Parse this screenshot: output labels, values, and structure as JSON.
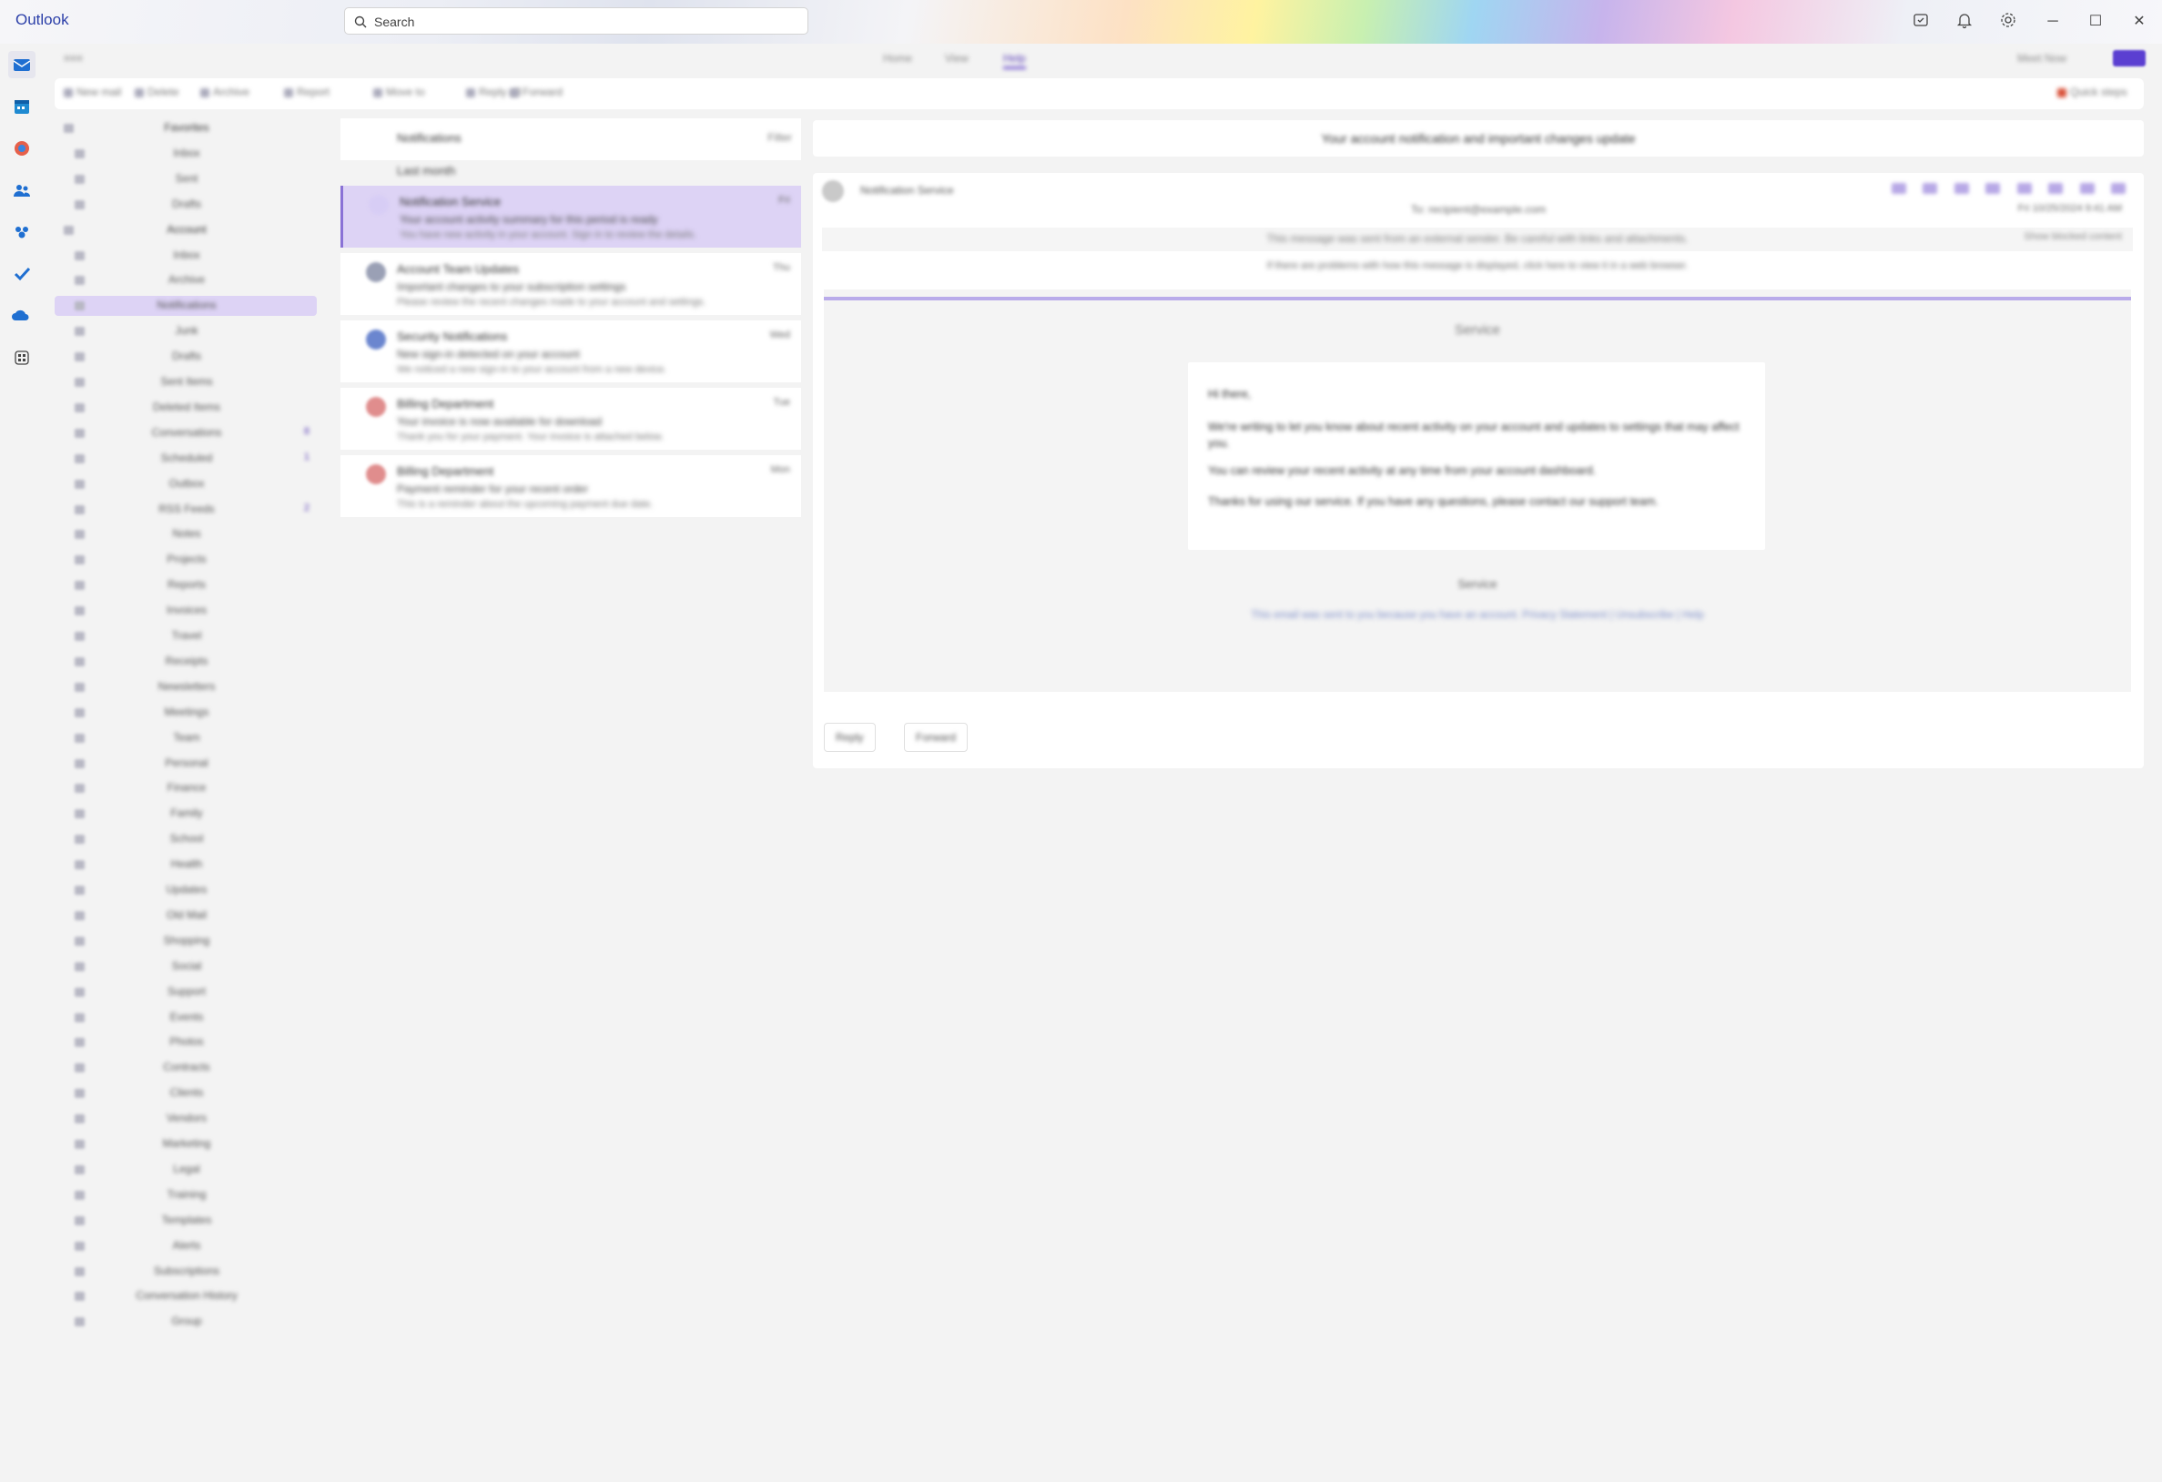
{
  "app": {
    "title": "Outlook"
  },
  "search": {
    "placeholder": "Search"
  },
  "titlebar_icons": [
    "my-day-icon",
    "bell-icon",
    "gear-icon"
  ],
  "window_controls": {
    "minimize": "─",
    "maximize": "☐",
    "close": "✕"
  },
  "rail": {
    "items": [
      "mail-icon",
      "calendar-icon",
      "copilot-icon",
      "people-icon",
      "groups-icon",
      "todo-icon",
      "onedrive-icon",
      "apps-icon"
    ]
  },
  "ribbon": {
    "menu": "≡≡≡",
    "tabs": [
      "Home",
      "View",
      "Help"
    ],
    "commands": [
      "New mail",
      "Delete",
      "Archive",
      "Report",
      "Move to",
      "Reply all",
      "Forward",
      "Quick steps"
    ],
    "right_label": "Meet Now"
  },
  "folders": {
    "items": [
      {
        "label": "Favorites",
        "section": true
      },
      {
        "label": "Inbox"
      },
      {
        "label": "Sent"
      },
      {
        "label": "Drafts"
      },
      {
        "label": "Account",
        "section": true
      },
      {
        "label": "Inbox"
      },
      {
        "label": "Archive"
      },
      {
        "label": "Notifications",
        "selected": true
      },
      {
        "label": "Junk"
      },
      {
        "label": "Drafts"
      },
      {
        "label": "Sent Items"
      },
      {
        "label": "Deleted Items"
      },
      {
        "label": "Conversations",
        "count": "8"
      },
      {
        "label": "Scheduled",
        "count": "1"
      },
      {
        "label": "Outbox"
      },
      {
        "label": "RSS Feeds",
        "count": "2"
      },
      {
        "label": "Notes"
      },
      {
        "label": "Projects"
      },
      {
        "label": "Reports"
      },
      {
        "label": "Invoices"
      },
      {
        "label": "Travel"
      },
      {
        "label": "Receipts"
      },
      {
        "label": "Newsletters"
      },
      {
        "label": "Meetings"
      },
      {
        "label": "Team"
      },
      {
        "label": "Personal"
      },
      {
        "label": "Finance"
      },
      {
        "label": "Family"
      },
      {
        "label": "School"
      },
      {
        "label": "Health"
      },
      {
        "label": "Updates"
      },
      {
        "label": "Old Mail"
      },
      {
        "label": "Shopping"
      },
      {
        "label": "Social"
      },
      {
        "label": "Support"
      },
      {
        "label": "Events"
      },
      {
        "label": "Photos"
      },
      {
        "label": "Contracts"
      },
      {
        "label": "Clients"
      },
      {
        "label": "Vendors"
      },
      {
        "label": "Marketing"
      },
      {
        "label": "Legal"
      },
      {
        "label": "Training"
      },
      {
        "label": "Templates"
      },
      {
        "label": "Alerts"
      },
      {
        "label": "Subscriptions"
      },
      {
        "label": "Conversation History"
      },
      {
        "label": "Group"
      }
    ]
  },
  "message_list": {
    "title": "Notifications",
    "group_label": "Last month",
    "tools": "Filter",
    "messages": [
      {
        "sender": "Notification Service",
        "time": "Fri",
        "subject": "Your account activity summary for this period is ready",
        "preview": "You have new activity in your account. Sign in to review the details.",
        "avatar": "#d7cdf5",
        "selected": true
      },
      {
        "sender": "Account Team Updates",
        "time": "Thu",
        "subject": "Important changes to your subscription settings",
        "preview": "Please review the recent changes made to your account and settings.",
        "avatar": "#9aa0b5"
      },
      {
        "sender": "Security Notifications",
        "time": "Wed",
        "subject": "New sign-in detected on your account",
        "preview": "We noticed a new sign-in to your account from a new device.",
        "avatar": "#6b86cf"
      },
      {
        "sender": "Billing Department",
        "time": "Tue",
        "subject": "Your invoice is now available for download",
        "preview": "Thank you for your payment. Your invoice is attached below.",
        "avatar": "#e08d8d"
      },
      {
        "sender": "Billing Department",
        "time": "Mon",
        "subject": "Payment reminder for your recent order",
        "preview": "This is a reminder about the upcoming payment due date.",
        "avatar": "#e08d8d"
      }
    ]
  },
  "reading_pane": {
    "subject": "Your account notification and important changes update",
    "from": "Notification Service",
    "to": "To: recipient@example.com",
    "date": "Fri 10/25/2024 9:41 AM",
    "notice": "This message was sent from an external sender. Be careful with links and attachments.",
    "notice_button": "Show blocked content",
    "info": "If there are problems with how this message is displayed, click here to view it in a web browser.",
    "brand": "Service",
    "card_greeting": "Hi there,",
    "card_p1": "We're writing to let you know about recent activity on your account and updates to settings that may affect you.",
    "card_p2": "You can review your recent activity at any time from your account dashboard.",
    "card_p3": "Thanks for using our service. If you have any questions, please contact our support team.",
    "footer_logo": "Service",
    "footer_text": "This email was sent to you because you have an account. Privacy Statement | Unsubscribe | Help",
    "reply_label": "Reply",
    "forward_label": "Forward"
  },
  "colors": {
    "accent": "#7b61d1",
    "selected_bg": "#ddd3f5",
    "app_title": "#2b3fa8"
  }
}
